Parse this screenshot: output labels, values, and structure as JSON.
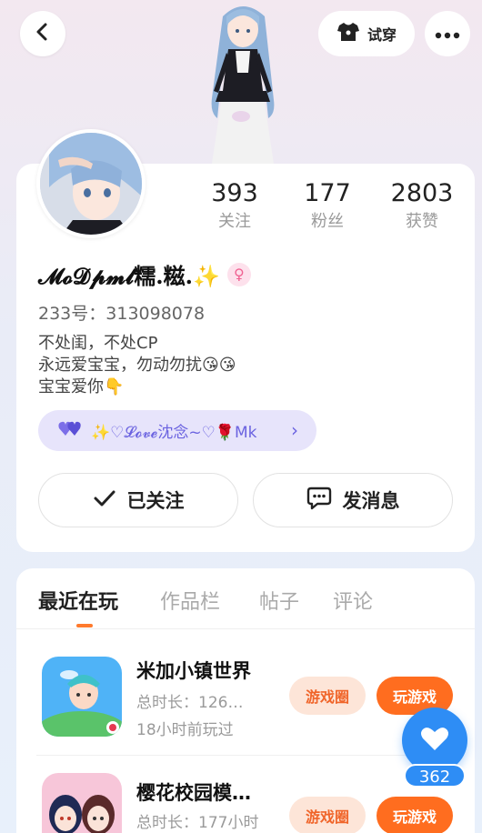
{
  "header": {
    "tryon_label": "试穿",
    "icons": {
      "back": "back-arrow-icon",
      "tryon": "shirt-icon",
      "more": "more-dots-icon"
    }
  },
  "profile": {
    "stats": [
      {
        "value": "393",
        "label": "关注"
      },
      {
        "value": "177",
        "label": "粉丝"
      },
      {
        "value": "2803",
        "label": "获赞"
      }
    ],
    "username": "𝓜𝓸𝓓𝓹𝓶𝓵糯.糍.✨",
    "gender_symbol": "♀",
    "uid": "233号：313098078",
    "bio_lines": [
      "不处闺，不处CP",
      "永远爱宝宝，勿动勿扰😘😘",
      "宝宝爱你👇"
    ],
    "badge_text": "✨♡𝓛𝓸𝓿𝓮沈念~♡🌹Mk",
    "badge_chevron": "›",
    "follow_label": "已关注",
    "message_label": "发消息"
  },
  "tabs": [
    {
      "label": "最近在玩",
      "active": true
    },
    {
      "label": "作品栏",
      "active": false
    },
    {
      "label": "帖子",
      "active": false
    },
    {
      "label": "评论",
      "active": false
    }
  ],
  "games": [
    {
      "title": "米加小镇世界",
      "duration": "总时长：126…",
      "last_played": "18小时前玩过",
      "circle_label": "游戏圈",
      "play_label": "玩游戏"
    },
    {
      "title": "樱花校园模…",
      "duration": "总时长：177小时",
      "last_played": "",
      "circle_label": "游戏圈",
      "play_label": "玩游戏"
    }
  ],
  "like": {
    "count": "362"
  },
  "colors": {
    "accent_orange": "#ff6d1f",
    "like_blue": "#2e8df5",
    "badge_purple": "#6b63e0"
  }
}
